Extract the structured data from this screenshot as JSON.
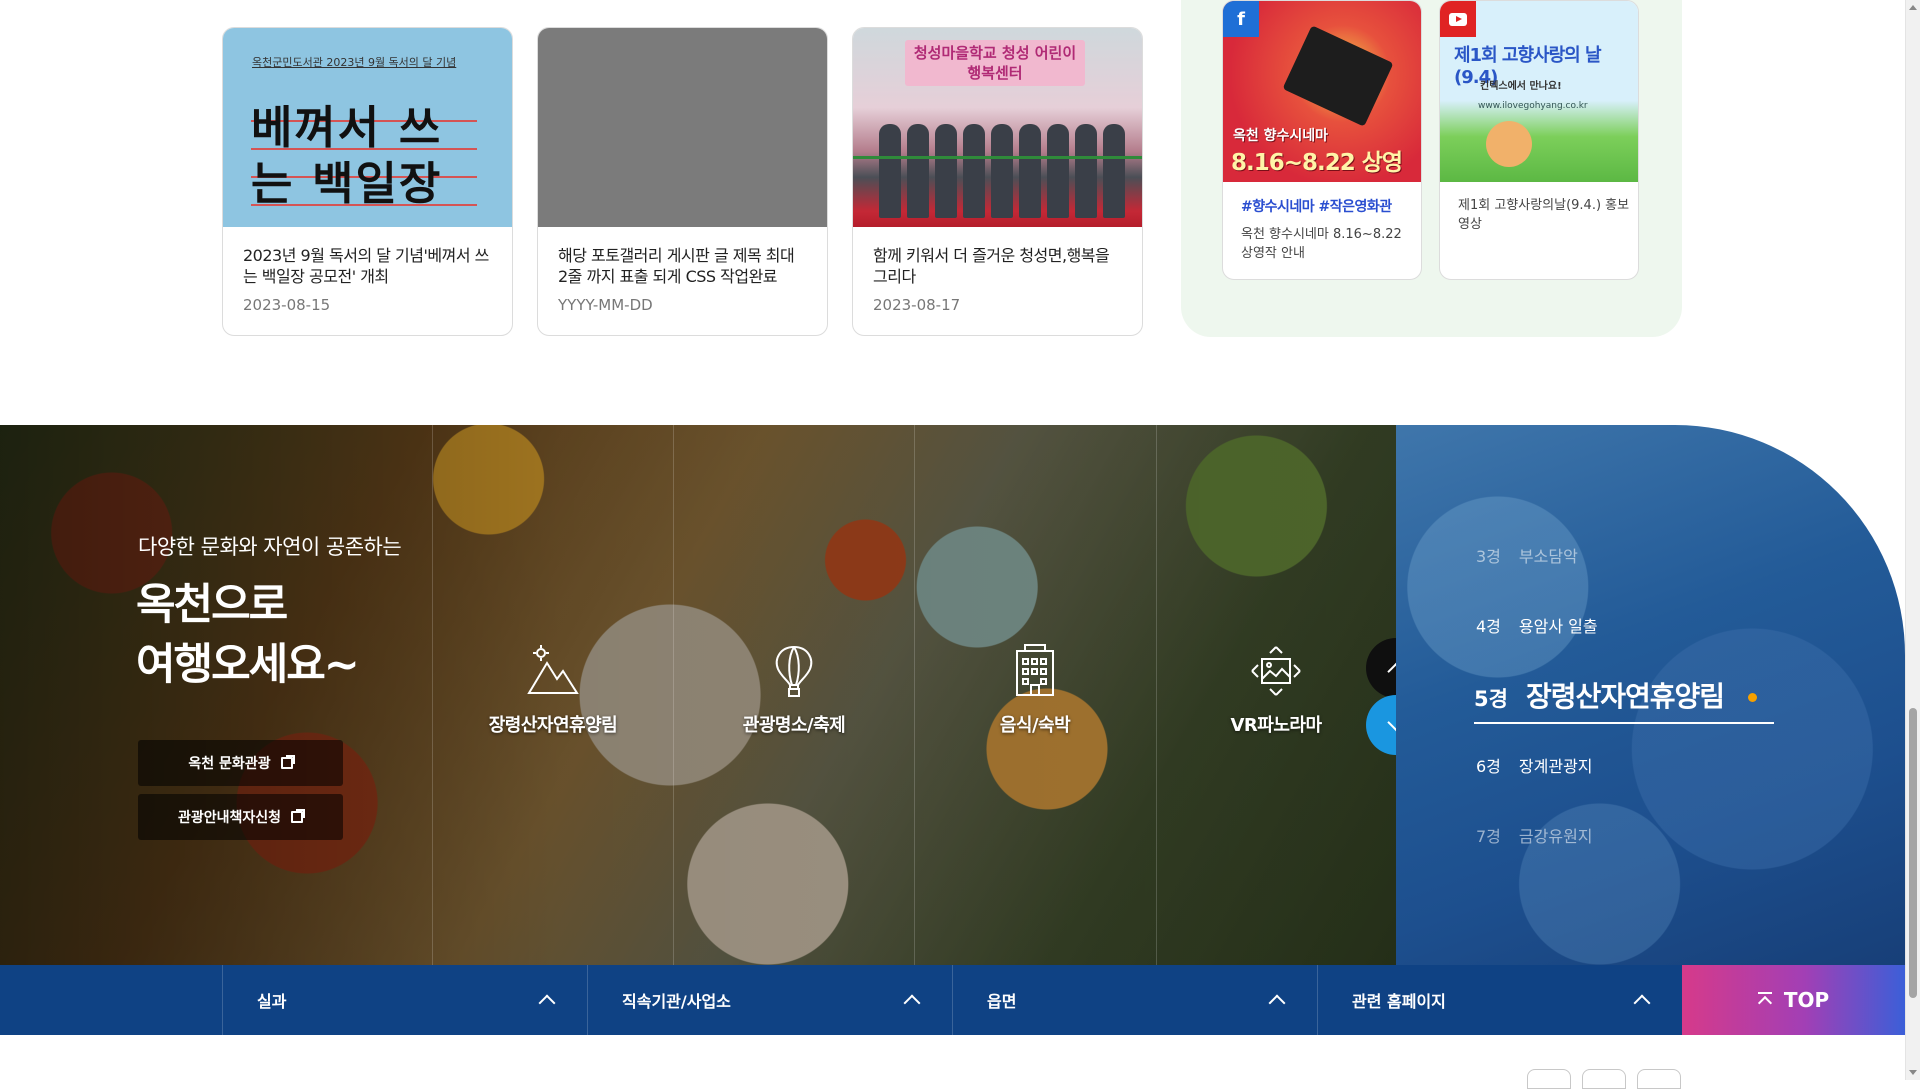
{
  "news_cards": [
    {
      "image_caption": "옥천군민도서관 2023년 9월 독서의 달 기념",
      "image_text": "베껴서 쓰는 백일장",
      "title": "2023년 9월 독서의 달 기념'베껴서 쓰는 백일장 공모전' 개최",
      "date": "2023-08-15"
    },
    {
      "title": "해당 포토갤러리 게시판 글 제목 최대 2줄 까지 표출 되게 CSS 작업완료",
      "date": "YYYY-MM-DD"
    },
    {
      "image_sign": "청성마을학교 청성 어린이 행복센터",
      "title": "함께 키워서 더 즐거운 청성면,행복을 그리다",
      "date": "2023-08-17"
    }
  ],
  "social": [
    {
      "network_icon": "facebook-icon",
      "image_line1": "옥천 향수시네마",
      "image_line2": "8.16~8.22 상영작 안내",
      "tags": "#향수시네마 #작은영화관",
      "desc": "옥천 향수시네마 8.16~8.22 상영작 안내"
    },
    {
      "network_icon": "youtube-icon",
      "image_line1": "제1회 고향사랑의 날(9.4)",
      "image_line2": "킨텍스에서 만나요!",
      "image_line3": "www.ilovegohyang.co.kr",
      "desc": "제1회 고향사랑의날(9.4.) 홍보영상"
    }
  ],
  "travel": {
    "subtitle": "다양한 문화와 자연이 공존하는",
    "title_line1": "옥천으로",
    "title_line2": "여행오세요~",
    "links": [
      {
        "label": "옥천 문화관광",
        "icon": "external-link-icon"
      },
      {
        "label": "관광안내책자신청",
        "icon": "external-link-icon"
      }
    ],
    "categories": [
      {
        "label": "장령산자연휴양림",
        "icon": "mountain-icon"
      },
      {
        "label": "관광명소/축제",
        "icon": "balloon-icon"
      },
      {
        "label": "음식/숙박",
        "icon": "building-icon"
      },
      {
        "label": "VR파노라마",
        "icon": "panorama-icon"
      }
    ],
    "scenes": [
      {
        "num": "3경",
        "name": "부소담악"
      },
      {
        "num": "4경",
        "name": "용암사 일출"
      },
      {
        "num": "5경",
        "name": "장령산자연휴양림"
      },
      {
        "num": "6경",
        "name": "장계관광지"
      },
      {
        "num": "7경",
        "name": "금강유원지"
      }
    ],
    "active_scene_index": 2
  },
  "footer_nav": [
    {
      "label": "실과"
    },
    {
      "label": "직속기관/사업소"
    },
    {
      "label": "읍면"
    },
    {
      "label": "관련 홈페이지"
    }
  ],
  "top_button": "TOP",
  "colors": {
    "footer_bar": "#0f4284",
    "active_dot": "#f5a000",
    "down_button": "#1a96e0",
    "top_button_start": "#d63a8a",
    "top_button_end": "#3b5fd8"
  }
}
